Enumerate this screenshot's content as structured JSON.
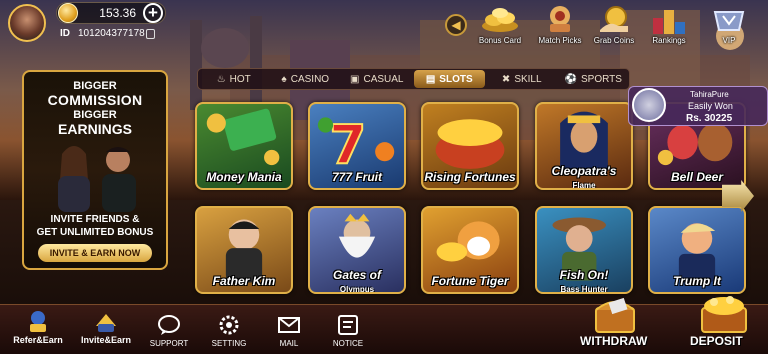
{
  "player": {
    "balance": "153.36",
    "id_label": "ID",
    "id_value": "101204377178"
  },
  "top_icons": [
    {
      "label": "Bonus Card",
      "icon": "bonus-card-icon"
    },
    {
      "label": "Match Picks",
      "icon": "match-picks-icon"
    },
    {
      "label": "Grab Coins",
      "icon": "grab-coins-icon"
    },
    {
      "label": "Rankings",
      "icon": "rankings-icon"
    },
    {
      "label": "VIP",
      "icon": "vip-icon"
    }
  ],
  "promo": {
    "line1": "BIGGER",
    "line2": "COMMISSION",
    "line3": "BIGGER",
    "line4": "EARNINGS",
    "line5": "INVITE FRIENDS &",
    "line6": "GET UNLIMITED BONUS",
    "button": "INVITE & EARN NOW"
  },
  "tabs": [
    {
      "label": "HOT",
      "icon": "fire-icon"
    },
    {
      "label": "CASINO",
      "icon": "casino-icon"
    },
    {
      "label": "CASUAL",
      "icon": "gamepad-icon"
    },
    {
      "label": "SLOTS",
      "icon": "slots-icon",
      "active": true
    },
    {
      "label": "SKILL",
      "icon": "skill-icon"
    },
    {
      "label": "SPORTS",
      "icon": "sports-icon"
    }
  ],
  "games": [
    {
      "name": "Money Mania"
    },
    {
      "name": "777 Fruit"
    },
    {
      "name": "Rising Fortunes"
    },
    {
      "name": "Cleopatra's",
      "sub": "Flame"
    },
    {
      "name": "Bell Deer"
    },
    {
      "name": "Father Kim"
    },
    {
      "name": "Gates of",
      "sub": "Olympus"
    },
    {
      "name": "Fortune Tiger"
    },
    {
      "name": "Fish On!",
      "sub": "Bass Hunter"
    },
    {
      "name": "Trump It"
    }
  ],
  "win_notice": {
    "user": "TahiraPure",
    "text": "Easily Won",
    "amount": "Rs. 30225"
  },
  "bottom_nav": [
    {
      "label": "Refer&Earn",
      "icon": "refer-earn-icon"
    },
    {
      "label": "Invite&Earn",
      "icon": "invite-earn-icon"
    },
    {
      "label": "SUPPORT",
      "icon": "chat-bubble-icon"
    },
    {
      "label": "SETTING",
      "icon": "gear-icon"
    },
    {
      "label": "MAIL",
      "icon": "mail-icon"
    },
    {
      "label": "NOTICE",
      "icon": "notice-icon"
    }
  ],
  "actions": {
    "withdraw": "WITHDRAW",
    "deposit": "DEPOSIT"
  },
  "colors": {
    "gold_border": "#e0b048",
    "active_tab": "#d6a24a",
    "win_bg": "#46285a"
  }
}
